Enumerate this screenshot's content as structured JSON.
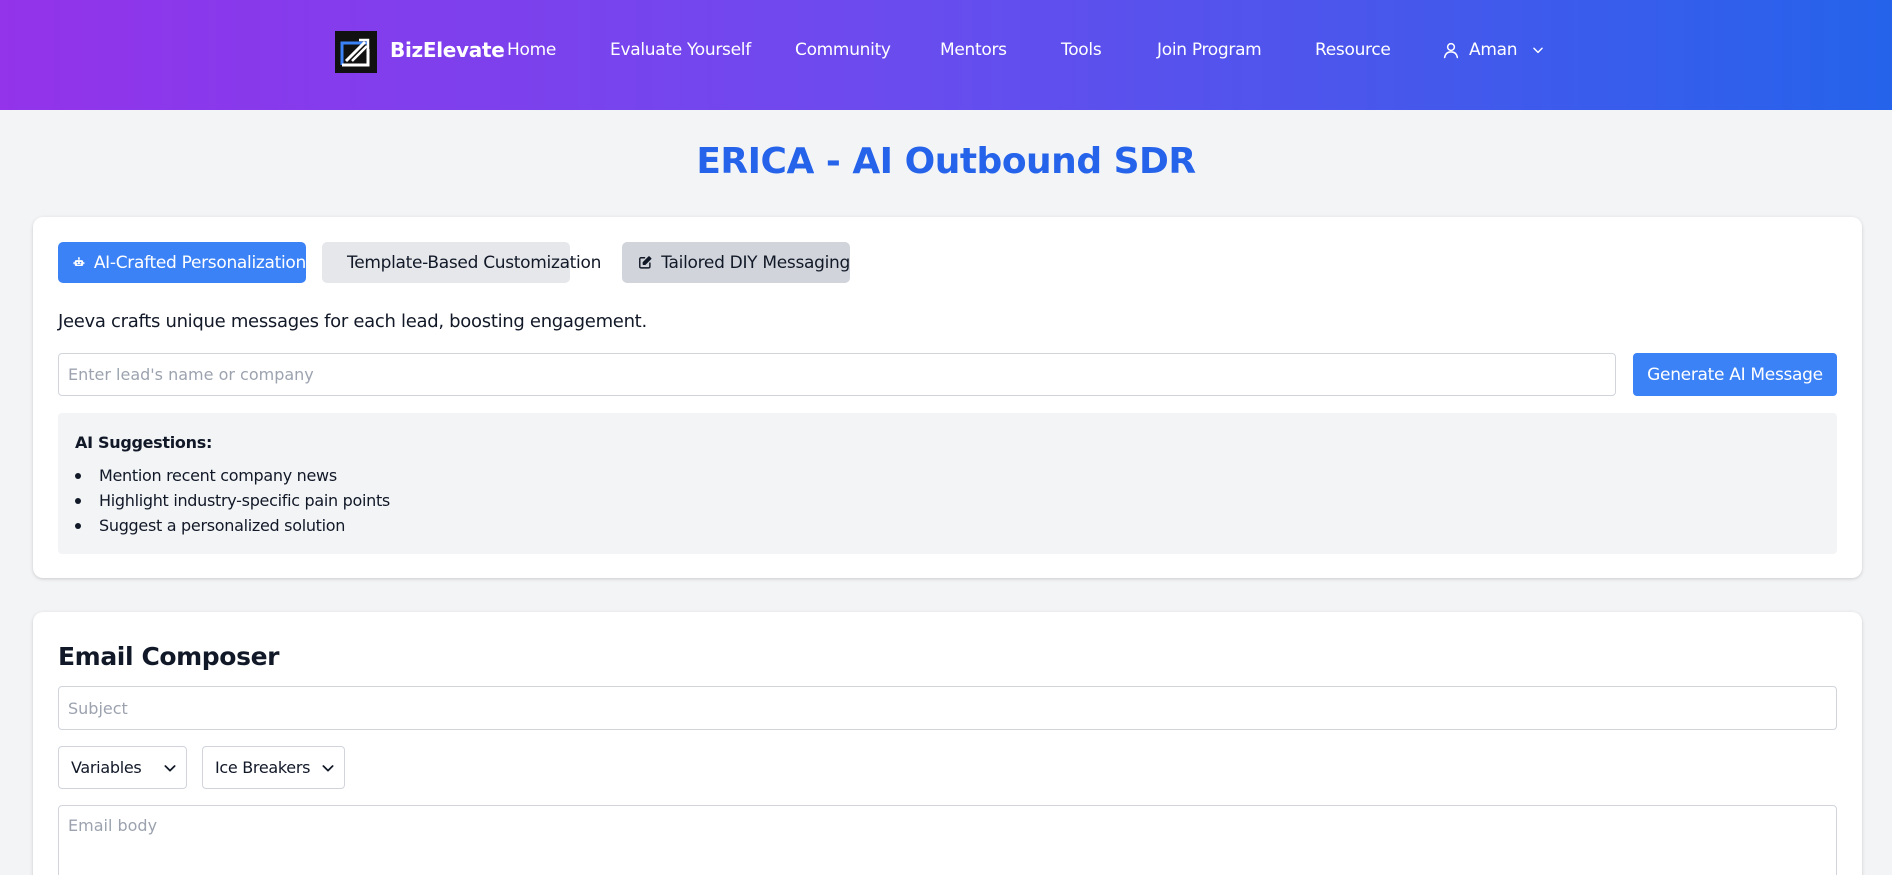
{
  "header": {
    "brand": "BizElevate",
    "nav": [
      {
        "label": "Home"
      },
      {
        "label": "Evaluate Yourself"
      },
      {
        "label": "Community"
      },
      {
        "label": "Mentors"
      },
      {
        "label": "Tools"
      },
      {
        "label": "Join Program"
      },
      {
        "label": "Resource"
      }
    ],
    "user": {
      "name": "Aman",
      "icon": "user-icon",
      "caret": "chevron-down-icon"
    },
    "gradient": [
      "#9333ea",
      "#2563eb"
    ]
  },
  "page": {
    "title": "ERICA - AI Outbound SDR",
    "title_color": "#2563eb",
    "background": "#f3f4f6"
  },
  "personalization": {
    "tabs": [
      {
        "label": "AI-Crafted Personalization",
        "icon": "robot-icon",
        "active": true
      },
      {
        "label": "Template-Based Customization",
        "icon": "gear-icon",
        "active": false
      },
      {
        "label": "Tailored DIY Messaging",
        "icon": "edit-icon",
        "active": false
      }
    ],
    "description": "Jeeva crafts unique messages for each lead, boosting engagement.",
    "lead_input": {
      "placeholder": "Enter lead's name or company",
      "value": ""
    },
    "generate_button": "Generate AI Message",
    "accent": "#3b82f6",
    "suggestions": {
      "title": "AI Suggestions:",
      "items": [
        "Mention recent company news",
        "Highlight industry-specific pain points",
        "Suggest a personalized solution"
      ]
    }
  },
  "composer": {
    "title": "Email Composer",
    "subject": {
      "placeholder": "Subject",
      "value": ""
    },
    "selects": {
      "variables": {
        "selected": "Variables"
      },
      "ice_breakers": {
        "selected": "Ice Breakers"
      }
    },
    "body": {
      "placeholder": "Email body",
      "value": ""
    }
  }
}
